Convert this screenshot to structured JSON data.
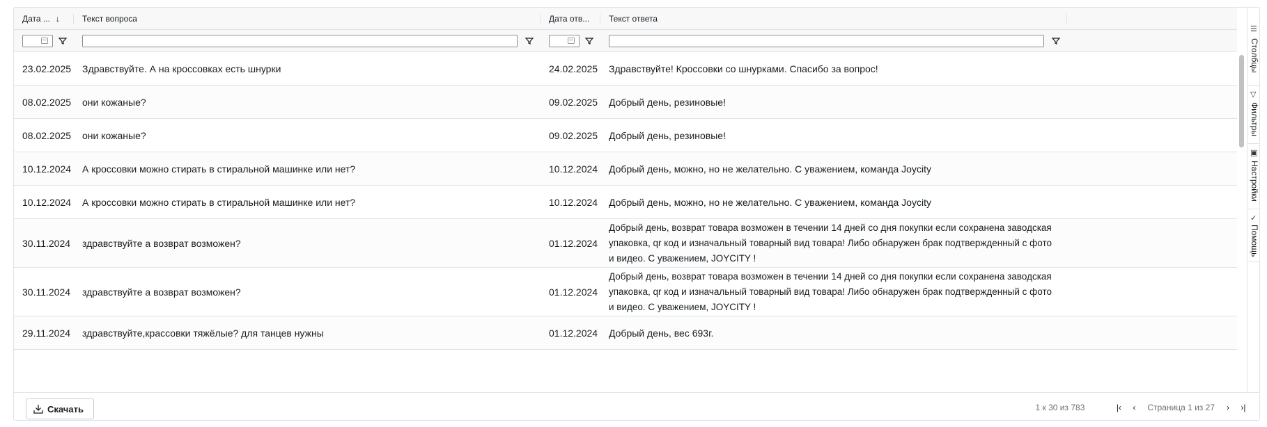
{
  "columns": [
    {
      "label": "Дата ...",
      "sort": "↓"
    },
    {
      "label": "Текст вопроса"
    },
    {
      "label": "Дата отв..."
    },
    {
      "label": "Текст ответа"
    }
  ],
  "rows": [
    {
      "q_date": "23.02.2025",
      "q_text": "Здравствуйте. А на кроссовках есть шнурки",
      "a_date": "24.02.2025",
      "a_text": "Здравствуйте! Кроссовки со шнурками. Спасибо за вопрос!"
    },
    {
      "q_date": "08.02.2025",
      "q_text": "они кожаные?",
      "a_date": "09.02.2025",
      "a_text": "Добрый день, резиновые!"
    },
    {
      "q_date": "08.02.2025",
      "q_text": "они кожаные?",
      "a_date": "09.02.2025",
      "a_text": "Добрый день, резиновые!"
    },
    {
      "q_date": "10.12.2024",
      "q_text": "А кроссовки можно стирать в стиральной машинке или нет?",
      "a_date": "10.12.2024",
      "a_text": "Добрый день, можно, но не желательно. С уважением, команда Joycity"
    },
    {
      "q_date": "10.12.2024",
      "q_text": "А кроссовки можно стирать в стиральной машинке или нет?",
      "a_date": "10.12.2024",
      "a_text": "Добрый день, можно, но не желательно. С уважением, команда Joycity"
    },
    {
      "q_date": "30.11.2024",
      "q_text": "здравствуйте а возврат возможен?",
      "a_date": "01.12.2024",
      "a_text": "Добрый день, возврат товара возможен в течении 14 дней со дня покупки если сохранена заводская упаковка, qr код и изначальный товарный вид товара! Либо обнаружен брак подтвержденный с фото и видео. С уважением, JOYCITY !"
    },
    {
      "q_date": "30.11.2024",
      "q_text": "здравствуйте а возврат возможен?",
      "a_date": "01.12.2024",
      "a_text": "Добрый день, возврат товара возможен в течении 14 дней со дня покупки если сохранена заводская упаковка, qr код и изначальный товарный вид товара! Либо обнаружен брак подтвержденный с фото и видео. С уважением, JOYCITY !"
    },
    {
      "q_date": "29.11.2024",
      "q_text": "здравствуйте,крассовки тяжёлые? для танцев нужны",
      "a_date": "01.12.2024",
      "a_text": "Добрый день, вес 693г."
    }
  ],
  "sidebar": {
    "columns_label": "Столбцы",
    "filters_label": "Фильтры",
    "settings_label": "Настройки",
    "help_label": "Помощь"
  },
  "footer": {
    "download_label": "Скачать",
    "count_text": "1 к 30 из 783",
    "page_text": "Страница 1 из 27"
  },
  "icons": {
    "sort": "arrow-down-icon",
    "filter": "funnel-icon",
    "calendar": "calendar-icon",
    "download": "download-icon",
    "first": "first-page-icon",
    "prev": "prev-page-icon",
    "next": "next-page-icon",
    "last": "last-page-icon"
  }
}
